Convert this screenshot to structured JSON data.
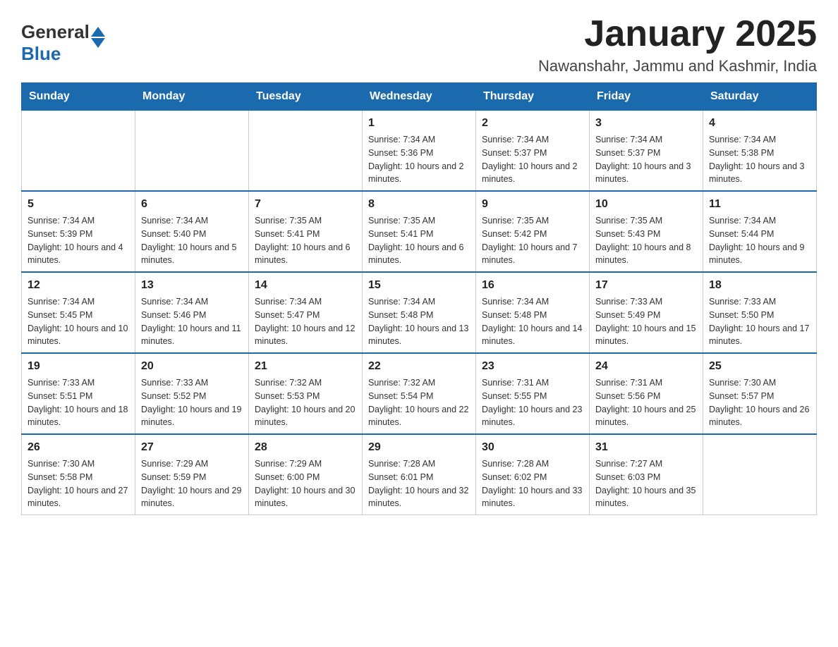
{
  "header": {
    "logo_general": "General",
    "logo_blue": "Blue",
    "month_title": "January 2025",
    "location": "Nawanshahr, Jammu and Kashmir, India"
  },
  "days_of_week": [
    "Sunday",
    "Monday",
    "Tuesday",
    "Wednesday",
    "Thursday",
    "Friday",
    "Saturday"
  ],
  "weeks": [
    [
      {
        "day": "",
        "info": ""
      },
      {
        "day": "",
        "info": ""
      },
      {
        "day": "",
        "info": ""
      },
      {
        "day": "1",
        "info": "Sunrise: 7:34 AM\nSunset: 5:36 PM\nDaylight: 10 hours and 2 minutes."
      },
      {
        "day": "2",
        "info": "Sunrise: 7:34 AM\nSunset: 5:37 PM\nDaylight: 10 hours and 2 minutes."
      },
      {
        "day": "3",
        "info": "Sunrise: 7:34 AM\nSunset: 5:37 PM\nDaylight: 10 hours and 3 minutes."
      },
      {
        "day": "4",
        "info": "Sunrise: 7:34 AM\nSunset: 5:38 PM\nDaylight: 10 hours and 3 minutes."
      }
    ],
    [
      {
        "day": "5",
        "info": "Sunrise: 7:34 AM\nSunset: 5:39 PM\nDaylight: 10 hours and 4 minutes."
      },
      {
        "day": "6",
        "info": "Sunrise: 7:34 AM\nSunset: 5:40 PM\nDaylight: 10 hours and 5 minutes."
      },
      {
        "day": "7",
        "info": "Sunrise: 7:35 AM\nSunset: 5:41 PM\nDaylight: 10 hours and 6 minutes."
      },
      {
        "day": "8",
        "info": "Sunrise: 7:35 AM\nSunset: 5:41 PM\nDaylight: 10 hours and 6 minutes."
      },
      {
        "day": "9",
        "info": "Sunrise: 7:35 AM\nSunset: 5:42 PM\nDaylight: 10 hours and 7 minutes."
      },
      {
        "day": "10",
        "info": "Sunrise: 7:35 AM\nSunset: 5:43 PM\nDaylight: 10 hours and 8 minutes."
      },
      {
        "day": "11",
        "info": "Sunrise: 7:34 AM\nSunset: 5:44 PM\nDaylight: 10 hours and 9 minutes."
      }
    ],
    [
      {
        "day": "12",
        "info": "Sunrise: 7:34 AM\nSunset: 5:45 PM\nDaylight: 10 hours and 10 minutes."
      },
      {
        "day": "13",
        "info": "Sunrise: 7:34 AM\nSunset: 5:46 PM\nDaylight: 10 hours and 11 minutes."
      },
      {
        "day": "14",
        "info": "Sunrise: 7:34 AM\nSunset: 5:47 PM\nDaylight: 10 hours and 12 minutes."
      },
      {
        "day": "15",
        "info": "Sunrise: 7:34 AM\nSunset: 5:48 PM\nDaylight: 10 hours and 13 minutes."
      },
      {
        "day": "16",
        "info": "Sunrise: 7:34 AM\nSunset: 5:48 PM\nDaylight: 10 hours and 14 minutes."
      },
      {
        "day": "17",
        "info": "Sunrise: 7:33 AM\nSunset: 5:49 PM\nDaylight: 10 hours and 15 minutes."
      },
      {
        "day": "18",
        "info": "Sunrise: 7:33 AM\nSunset: 5:50 PM\nDaylight: 10 hours and 17 minutes."
      }
    ],
    [
      {
        "day": "19",
        "info": "Sunrise: 7:33 AM\nSunset: 5:51 PM\nDaylight: 10 hours and 18 minutes."
      },
      {
        "day": "20",
        "info": "Sunrise: 7:33 AM\nSunset: 5:52 PM\nDaylight: 10 hours and 19 minutes."
      },
      {
        "day": "21",
        "info": "Sunrise: 7:32 AM\nSunset: 5:53 PM\nDaylight: 10 hours and 20 minutes."
      },
      {
        "day": "22",
        "info": "Sunrise: 7:32 AM\nSunset: 5:54 PM\nDaylight: 10 hours and 22 minutes."
      },
      {
        "day": "23",
        "info": "Sunrise: 7:31 AM\nSunset: 5:55 PM\nDaylight: 10 hours and 23 minutes."
      },
      {
        "day": "24",
        "info": "Sunrise: 7:31 AM\nSunset: 5:56 PM\nDaylight: 10 hours and 25 minutes."
      },
      {
        "day": "25",
        "info": "Sunrise: 7:30 AM\nSunset: 5:57 PM\nDaylight: 10 hours and 26 minutes."
      }
    ],
    [
      {
        "day": "26",
        "info": "Sunrise: 7:30 AM\nSunset: 5:58 PM\nDaylight: 10 hours and 27 minutes."
      },
      {
        "day": "27",
        "info": "Sunrise: 7:29 AM\nSunset: 5:59 PM\nDaylight: 10 hours and 29 minutes."
      },
      {
        "day": "28",
        "info": "Sunrise: 7:29 AM\nSunset: 6:00 PM\nDaylight: 10 hours and 30 minutes."
      },
      {
        "day": "29",
        "info": "Sunrise: 7:28 AM\nSunset: 6:01 PM\nDaylight: 10 hours and 32 minutes."
      },
      {
        "day": "30",
        "info": "Sunrise: 7:28 AM\nSunset: 6:02 PM\nDaylight: 10 hours and 33 minutes."
      },
      {
        "day": "31",
        "info": "Sunrise: 7:27 AM\nSunset: 6:03 PM\nDaylight: 10 hours and 35 minutes."
      },
      {
        "day": "",
        "info": ""
      }
    ]
  ]
}
